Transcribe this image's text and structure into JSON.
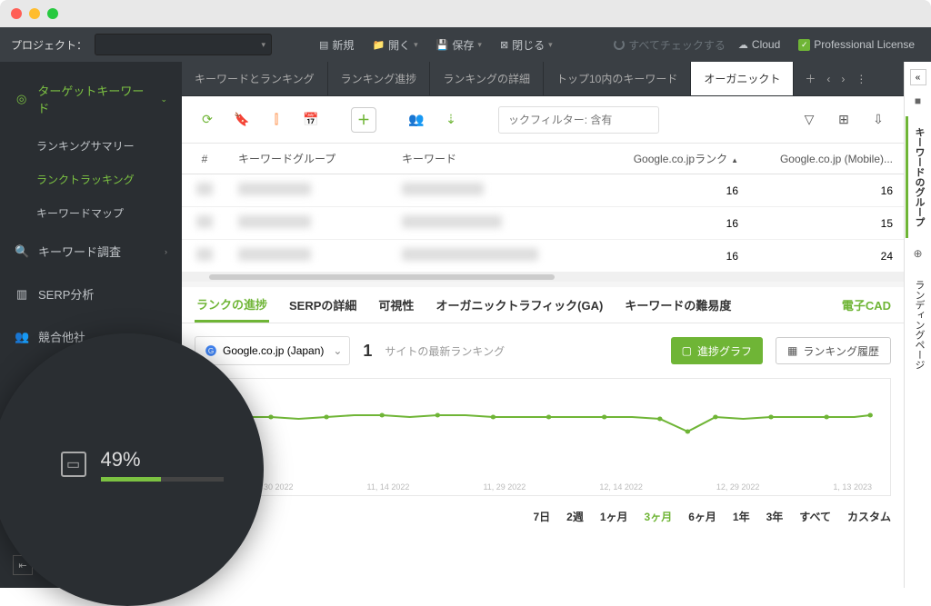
{
  "project_label": "プロジェクト：",
  "toolbar_top": {
    "new": "新規",
    "open": "開く",
    "save": "保存",
    "close": "閉じる",
    "check_all": "すべてチェックする",
    "cloud": "Cloud",
    "license": "Professional License"
  },
  "sidebar": {
    "target_keywords": "ターゲットキーワード",
    "ranking_summary": "ランキングサマリー",
    "rank_tracking": "ランクトラッキング",
    "keyword_map": "キーワードマップ",
    "keyword_research": "キーワード調査",
    "serp_analysis": "SERP分析",
    "competitors": "競合他社"
  },
  "tabs": {
    "tab0": "キーワードとランキング",
    "tab1": "ランキング進捗",
    "tab2": "ランキングの詳細",
    "tab3": "トップ10内のキーワード",
    "tab4": "オーガニックト"
  },
  "filter_placeholder": "ックフィルター: 含有",
  "table": {
    "headers": {
      "num": "#",
      "group": "キーワードグループ",
      "keyword": "キーワード",
      "rank1": "Google.co.jpランク",
      "rank2": "Google.co.jp (Mobile)..."
    },
    "rows": [
      {
        "r1": "16",
        "r2": "16"
      },
      {
        "r1": "16",
        "r2": "15"
      },
      {
        "r1": "16",
        "r2": "24"
      }
    ]
  },
  "lower_tabs": {
    "progress": "ランクの進捗",
    "serp_detail": "SERPの詳細",
    "visibility": "可視性",
    "organic_ga": "オーガニックトラフィック(GA)",
    "difficulty": "キーワードの難易度",
    "right": "電子CAD"
  },
  "se_selected": "Google.co.jp (Japan)",
  "latest_rank": "1",
  "latest_rank_label": "サイトの最新ランキング",
  "btn_progress": "進捗グラフ",
  "btn_history": "ランキング履歴",
  "chart_data": {
    "type": "line",
    "dates": [
      "10, 30 2022",
      "11, 14 2022",
      "11, 29 2022",
      "12, 14 2022",
      "12, 29 2022",
      "1, 13 2023"
    ],
    "values": [
      18,
      17,
      17,
      18,
      17,
      16,
      16,
      17,
      16,
      16,
      17,
      17,
      17,
      17,
      17,
      17,
      18,
      22,
      17,
      18,
      17,
      17,
      17,
      17,
      16
    ],
    "ylim": [
      0,
      30
    ]
  },
  "date_ranges": {
    "d7": "7日",
    "w2": "2週",
    "m1": "1ヶ月",
    "m3": "3ヶ月",
    "m6": "6ヶ月",
    "y1": "1年",
    "y3": "3年",
    "all": "すべて",
    "custom": "カスタム"
  },
  "vside": {
    "tab1": "キーワードのグループ",
    "tab2": "ランディングページ"
  },
  "progress": {
    "percent": "49%",
    "value": 49
  }
}
